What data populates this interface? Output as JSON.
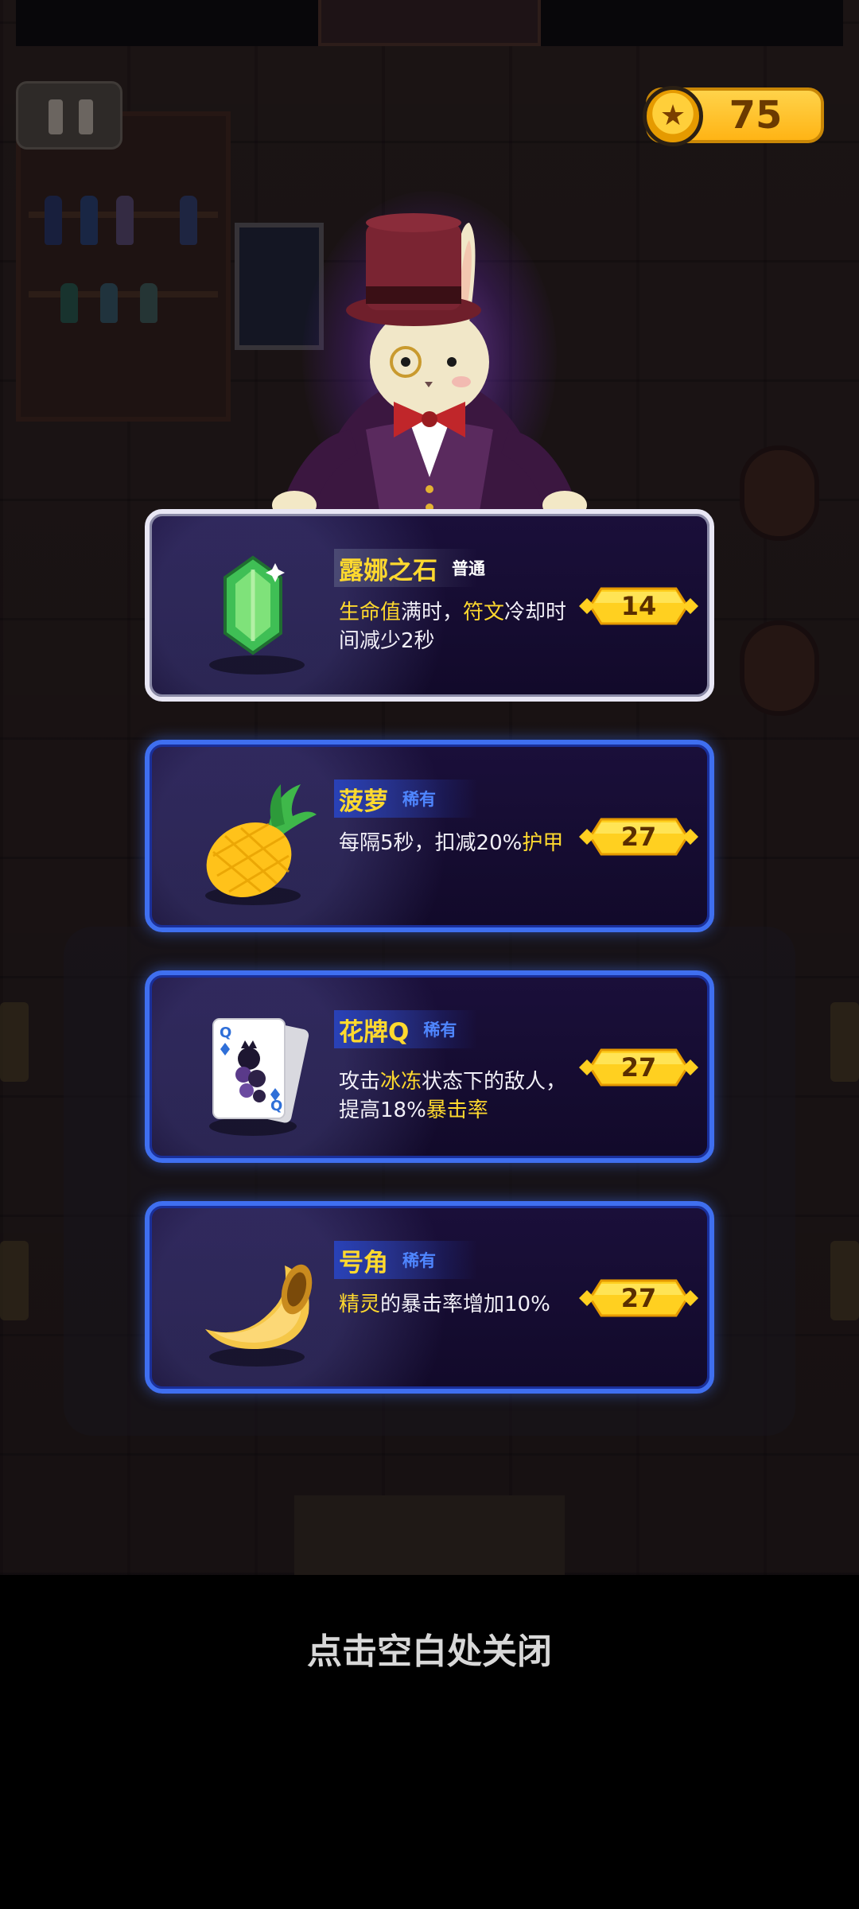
{
  "hud": {
    "coin_count": "75",
    "pause_icon": "pause-icon",
    "coin_icon": "star-coin-icon"
  },
  "merchant": {
    "icon": "rabbit-merchant-icon"
  },
  "items": [
    {
      "name": "露娜之石",
      "rarity": "普通",
      "icon": "green-gem-icon",
      "desc": [
        {
          "t": "生命值",
          "hl": true
        },
        {
          "t": "满时，",
          "hl": false
        },
        {
          "t": "符文",
          "hl": true
        },
        {
          "t": "冷却时间减少2秒",
          "hl": false
        }
      ],
      "price": "14"
    },
    {
      "name": "菠萝",
      "rarity": "稀有",
      "icon": "pineapple-icon",
      "desc": [
        {
          "t": "每隔5秒，扣减20%",
          "hl": false
        },
        {
          "t": "护甲",
          "hl": true
        }
      ],
      "price": "27"
    },
    {
      "name": "花牌Q",
      "rarity": "稀有",
      "icon": "queen-card-icon",
      "desc": [
        {
          "t": "攻击",
          "hl": false
        },
        {
          "t": "冰冻",
          "hl": true
        },
        {
          "t": "状态下的敌人，提高18%",
          "hl": false
        },
        {
          "t": "暴击率",
          "hl": true
        }
      ],
      "price": "27"
    },
    {
      "name": "号角",
      "rarity": "稀有",
      "icon": "horn-icon",
      "desc": [
        {
          "t": "精灵",
          "hl": true
        },
        {
          "t": "的暴击率增加10%",
          "hl": false
        }
      ],
      "price": "27"
    }
  ],
  "close_hint": "点击空白处关闭",
  "colors": {
    "highlight": "#ffd92e",
    "rare_border": "#3f6ff0",
    "common_border": "#e8e6f4",
    "price_tag": "#ffd020"
  }
}
